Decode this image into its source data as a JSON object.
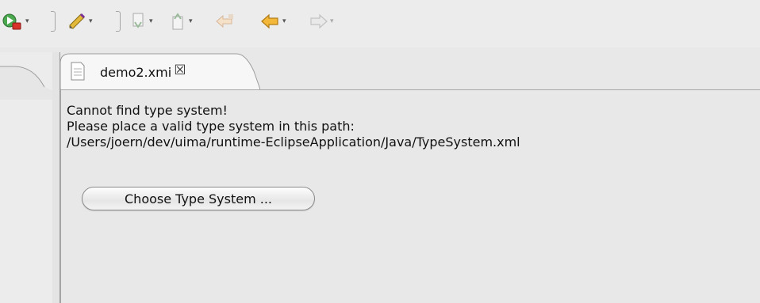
{
  "toolbar": {
    "items": [
      {
        "icon": "run-icon"
      },
      {
        "icon": "annotate-pen-icon"
      },
      {
        "icon": "next-annotation-icon"
      },
      {
        "icon": "previous-annotation-icon"
      },
      {
        "icon": "last-edit-location-icon"
      },
      {
        "icon": "back-icon"
      },
      {
        "icon": "forward-icon"
      }
    ],
    "dropdown_glyph": "▾",
    "colors": {
      "run": "#2f8f3a",
      "stop": "#d8332a",
      "nav_arrow": "#e8a017"
    }
  },
  "editor": {
    "tab": {
      "label": "demo2.xmi",
      "close_glyph": "☒",
      "icon": "document-icon"
    },
    "message_lines": [
      "Cannot find type system!",
      "Please place a valid type system in this path:",
      "/Users/joern/dev/uima/runtime-EclipseApplication/Java/TypeSystem.xml"
    ],
    "choose_button_label": "Choose Type System ..."
  }
}
